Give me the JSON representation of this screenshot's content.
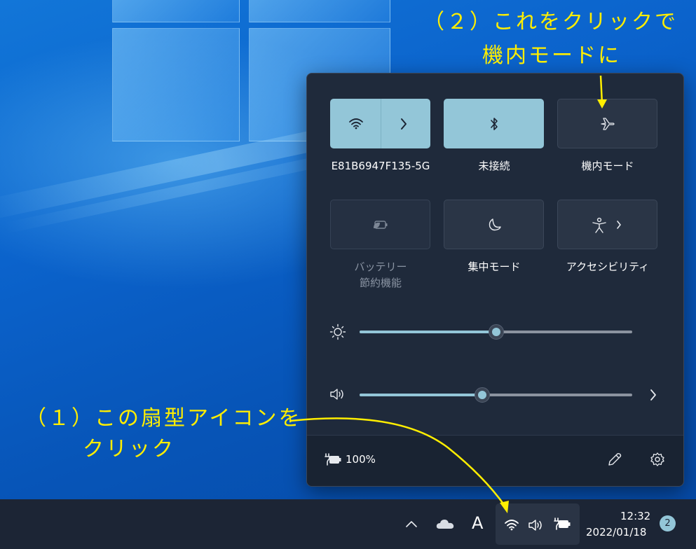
{
  "annotations": {
    "step2_line1": "（２）これをクリックで",
    "step2_line2": "機内モードに",
    "step1_line1": "（１）この扇型アイコンを",
    "step1_line2": "クリック"
  },
  "quick_settings": {
    "tiles": [
      {
        "label": "E81B6947F135-5G",
        "state": "on",
        "icon": "wifi-icon",
        "has_arrow": true
      },
      {
        "label": "未接続",
        "state": "on",
        "icon": "bluetooth-icon"
      },
      {
        "label": "機内モード",
        "state": "off",
        "icon": "airplane-icon"
      },
      {
        "label_line1": "バッテリー",
        "label_line2": "節約機能",
        "state": "disabled",
        "icon": "battery-saver-icon"
      },
      {
        "label": "集中モード",
        "state": "off",
        "icon": "moon-icon"
      },
      {
        "label": "アクセシビリティ",
        "state": "off",
        "icon": "accessibility-icon",
        "has_arrow": true
      }
    ],
    "brightness": {
      "icon": "brightness-icon",
      "value_percent": 50
    },
    "volume": {
      "icon": "speaker-icon",
      "value_percent": 45
    },
    "battery": {
      "icon": "battery-charging-icon",
      "label": "100%"
    },
    "footer_icons": [
      "edit-icon",
      "settings-icon"
    ]
  },
  "taskbar": {
    "tray_icons": [
      "chevron-up-icon",
      "onedrive-cloud-icon",
      "ime-icon",
      "wifi-icon",
      "speaker-icon",
      "battery-charging-icon"
    ],
    "ime_label": "A",
    "time": "12:32",
    "date": "2022/01/18",
    "notification_count": "2"
  },
  "colors": {
    "accent": "#93c6d8",
    "annotation": "#ffee00",
    "panel_bg": "#1f2a3b",
    "taskbar_bg": "#1c2535"
  }
}
